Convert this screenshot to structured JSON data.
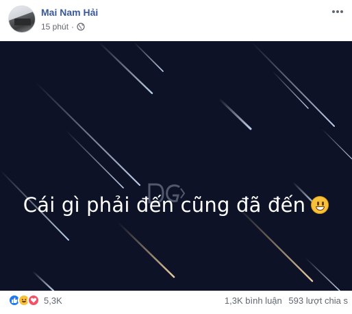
{
  "post": {
    "author": "Mai Nam Hải",
    "time": "15 phút",
    "separator": "·",
    "privacy_icon": "globe-icon",
    "more_icon": "more-options-icon"
  },
  "media": {
    "caption": "Cái gì phải đến cũng đã đến",
    "emoji": "grinning-face-emoji",
    "watermark": "ĐG",
    "background_color": "#0d1226"
  },
  "footer": {
    "reaction_icons": [
      "like-icon",
      "haha-icon",
      "love-icon"
    ],
    "reaction_count": "5,3K",
    "comments": "1,3K bình luận",
    "shares": "593 lượt chia s"
  },
  "colors": {
    "author_link": "#385898",
    "meta_text": "#616770",
    "like": "#2078f4",
    "haha": "#f7c13a",
    "love": "#f25268"
  }
}
